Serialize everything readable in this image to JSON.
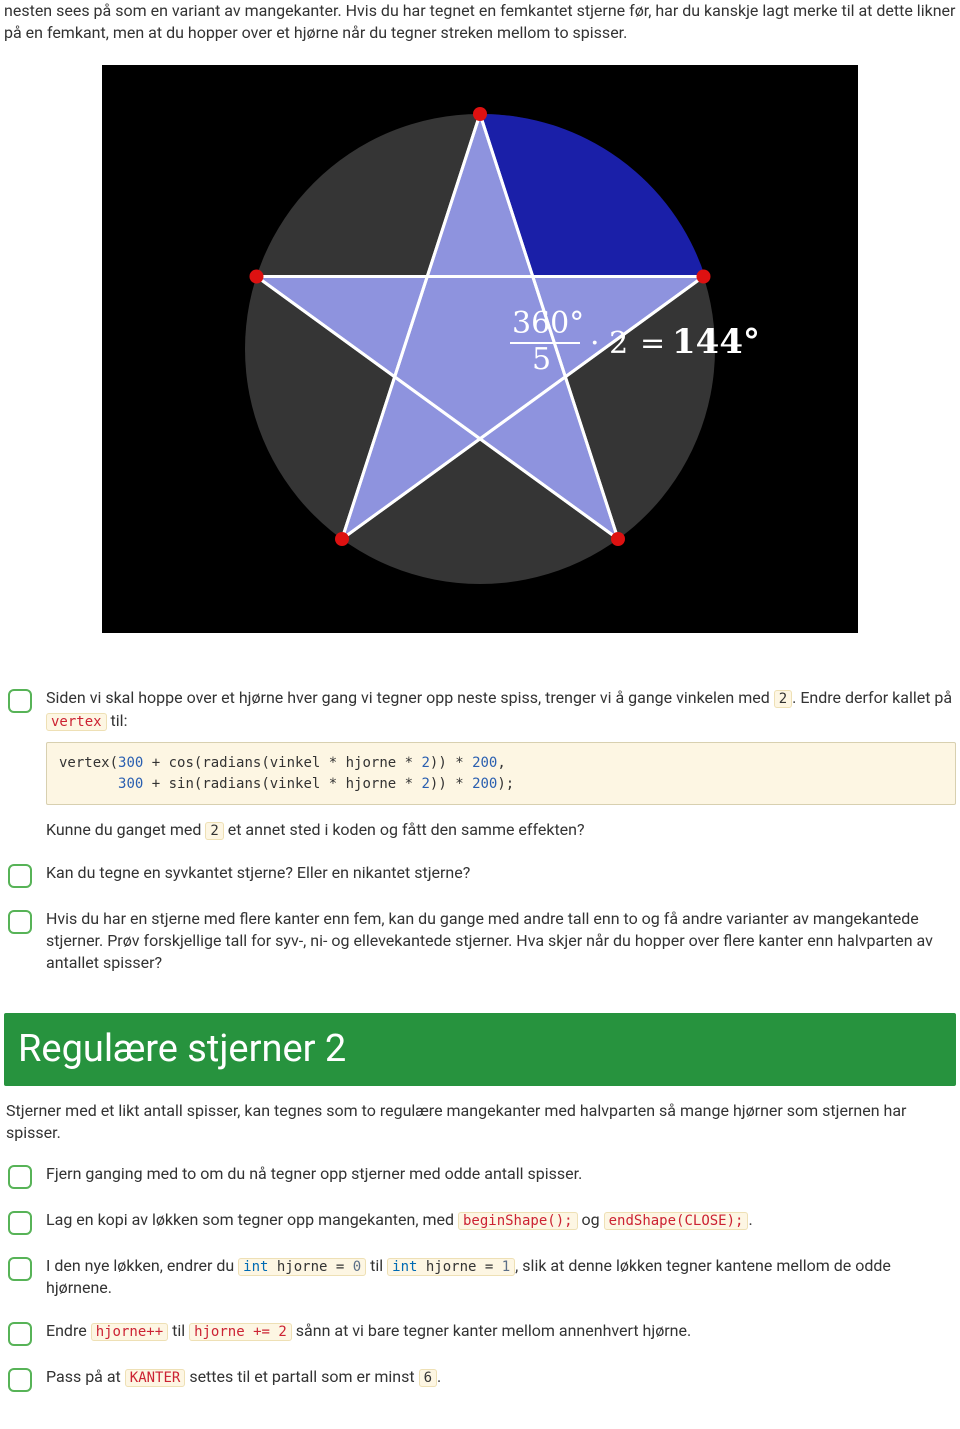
{
  "intro_paragraph": "nesten sees på som en variant av mangekanter. Hvis du har tegnet en femkantet stjerne før, har du kanskje lagt merke til at dette likner på en femkant, men at du hopper over et hjørne når du tegner streken mellom to spisser.",
  "diagram": {
    "formula_lhs_top": "360°",
    "formula_lhs_bot": "5",
    "formula_mid": "· 2",
    "formula_eq": "=",
    "formula_rhs": "144°"
  },
  "task1": {
    "t1": "Siden vi skal hoppe over et hjørne hver gang vi tegner opp neste spiss, trenger vi å gange vinkelen med ",
    "code1": "2",
    "t2": ". Endre derfor kallet på ",
    "code2": "vertex",
    "t3": " til:",
    "followup1": "Kunne du ganget med ",
    "followup_code": "2",
    "followup2": " et annet sted i koden og fått den samme effekten?"
  },
  "codeblock": {
    "l1a": "vertex(",
    "l1b": "300",
    "l1c": " + cos(radians(vinkel * hjorne * ",
    "l1d": "2",
    "l1e": ")) * ",
    "l1f": "200",
    "l1g": ",",
    "l2a": "       ",
    "l2b": "300",
    "l2c": " + sin(radians(vinkel * hjorne * ",
    "l2d": "2",
    "l2e": ")) * ",
    "l2f": "200",
    "l2g": ");"
  },
  "task2": "Kan du tegne en syvkantet stjerne? Eller en nikantet stjerne?",
  "task3": "Hvis du har en stjerne med flere kanter enn fem, kan du gange med andre tall enn to og få andre varianter av mangekantede stjerner. Prøv forskjellige tall for syv-, ni- og ellevekantede stjerner. Hva skjer når du hopper over flere kanter enn halvparten av antallet spisser?",
  "section2": {
    "title": "Regulære stjerner 2",
    "intro": "Stjerner med et likt antall spisser, kan tegnes som to regulære mangekanter med halvparten så mange hjørner som stjernen har spisser.",
    "item1": "Fjern ganging med to om du nå tegner opp stjerner med odde antall spisser.",
    "item2": {
      "t1": "Lag en kopi av løkken som tegner opp mangekanten, med ",
      "c1": "beginShape();",
      "t2": " og ",
      "c2": "endShape(CLOSE);",
      "t3": "."
    },
    "item3": {
      "t1": "I den nye løkken, endrer du ",
      "c1a": "int",
      "c1b": " hjorne = ",
      "c1c": "0",
      "t2": " til ",
      "c2a": "int",
      "c2b": " hjorne = ",
      "c2c": "1",
      "t3": ", slik at denne løkken tegner kantene mellom de odde hjørnene."
    },
    "item4": {
      "t1": "Endre ",
      "c1": "hjorne++",
      "t2": " til ",
      "c2": "hjorne += 2",
      "t3": " sånn at vi bare tegner kanter mellom annenhvert hjørne."
    },
    "item5": {
      "t1": "Pass på at ",
      "c1": "KANTER",
      "t2": " settes til et partall som er minst ",
      "c2": "6",
      "t3": "."
    }
  }
}
